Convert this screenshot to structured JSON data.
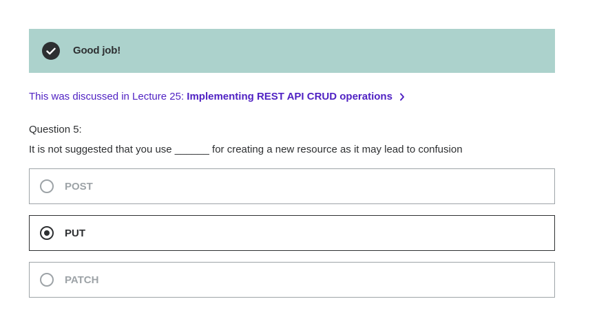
{
  "feedback": {
    "message": "Good job!",
    "icon": "checkmark-circle-icon",
    "background_color": "#acd2cc"
  },
  "lecture_link": {
    "prefix": "This was discussed in Lecture 25: ",
    "title": "Implementing REST API CRUD operations",
    "icon": "chevron-right-icon",
    "color": "#5022c3"
  },
  "question": {
    "number_label": "Question 5:",
    "text": "It is not suggested that you use ______ for creating a new resource as it may lead to confusion"
  },
  "options": [
    {
      "label": "POST",
      "selected": false
    },
    {
      "label": "PUT",
      "selected": true
    },
    {
      "label": "PATCH",
      "selected": false
    }
  ]
}
